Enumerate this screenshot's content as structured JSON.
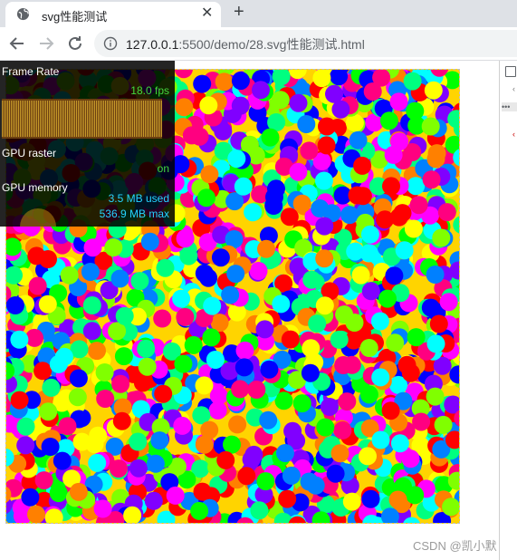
{
  "browser": {
    "tab": {
      "title": "svg性能测试",
      "close_icon": "close-icon",
      "favicon": "globe-icon"
    },
    "new_tab_icon": "plus-icon",
    "nav": {
      "back_icon": "arrow-left-icon",
      "forward_icon": "arrow-right-icon",
      "reload_icon": "reload-icon"
    },
    "address": {
      "host": "127.0.0.1",
      "path": ":5500/demo/28.svg性能测试.html",
      "info_icon": "info-icon"
    }
  },
  "hud": {
    "frame_rate_label": "Frame Rate",
    "fps": "18.0 fps",
    "gpu_raster_label": "GPU raster",
    "gpu_raster_value": "on",
    "gpu_memory_label": "GPU memory",
    "gpu_memory_used": "3.5 MB used",
    "gpu_memory_max": "536.9 MB max",
    "gpu_memory_fraction": 0.0065,
    "colors": {
      "fps_text": "#43d83e",
      "memory_text": "#26d3ff",
      "graph_bars": "#c79a2a"
    }
  },
  "canvas": {
    "circle_colors": [
      "#ff0000",
      "#ff00ff",
      "#00ffff",
      "#0000ff",
      "#00ff00",
      "#ffff00",
      "#8000ff",
      "#ff8000",
      "#80ff00",
      "#0080ff",
      "#ff0080",
      "#00ff80"
    ]
  },
  "devtools": {
    "toolbar_icon": "inspect-icon",
    "overflow_icon": "ellipsis-icon"
  },
  "watermark": "CSDN @凯小默"
}
